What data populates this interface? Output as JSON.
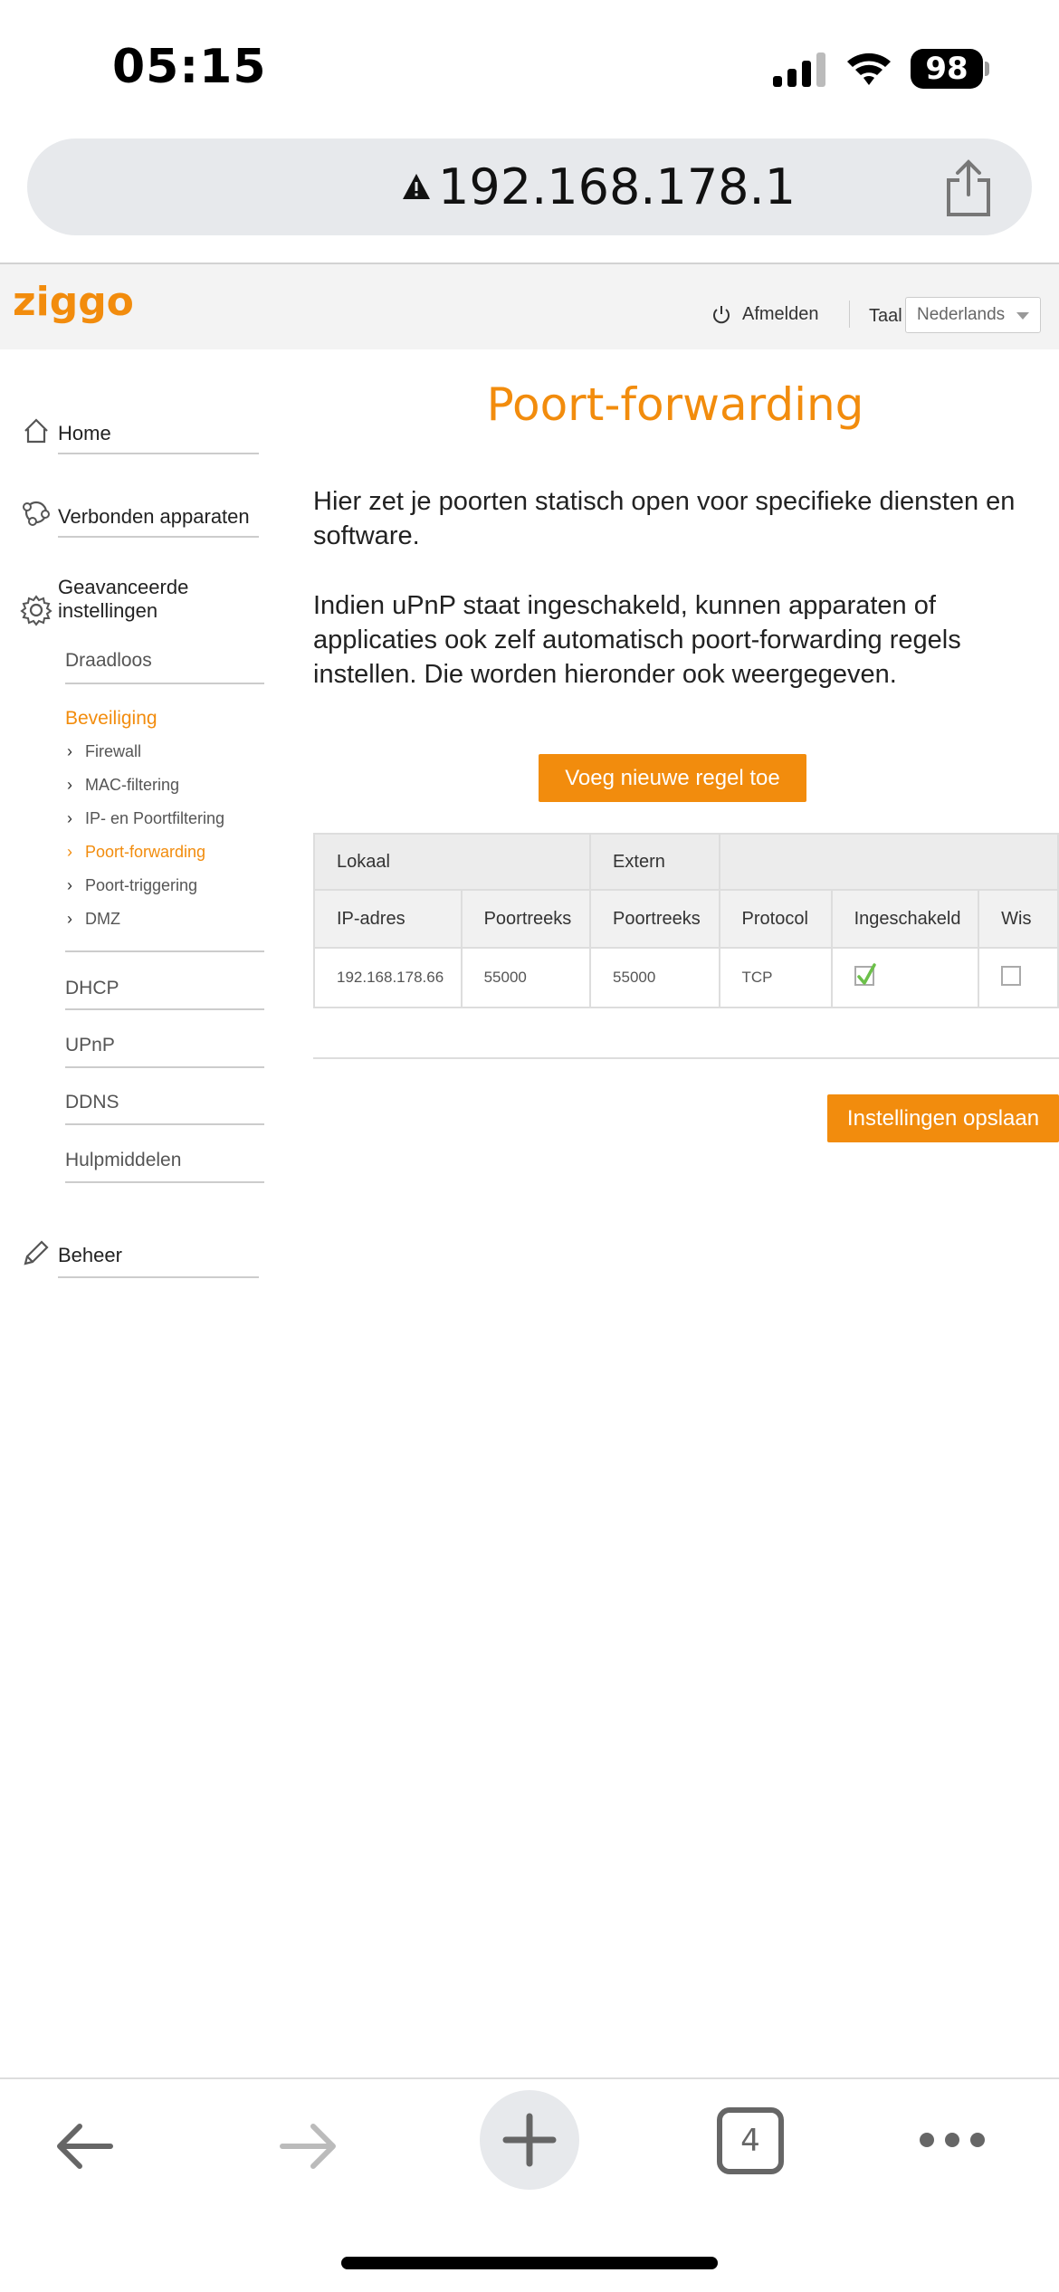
{
  "status_bar": {
    "time": "05:15",
    "battery": "98"
  },
  "browser": {
    "url": "192.168.178.1",
    "tabs_count": "4"
  },
  "header": {
    "brand": "ziggo",
    "logout_label": "Afmelden",
    "language_label": "Taal",
    "language_value": "Nederlands"
  },
  "sidebar": {
    "home": "Home",
    "connected_devices": "Verbonden apparaten",
    "advanced_line1": "Geavanceerde",
    "advanced_line2": "instellingen",
    "wireless": "Draadloos",
    "security": "Beveiliging",
    "security_items": [
      "Firewall",
      "MAC-filtering",
      "IP- en Poortfiltering",
      "Poort-forwarding",
      "Poort-triggering",
      "DMZ"
    ],
    "dhcp": "DHCP",
    "upnp": "UPnP",
    "ddns": "DDNS",
    "tools": "Hulpmiddelen",
    "management": "Beheer"
  },
  "main": {
    "title": "Poort-forwarding",
    "intro1": "Hier zet je poorten statisch open voor specifieke diensten en software.",
    "intro2": "Indien uPnP staat ingeschakeld, kunnen apparaten of applicaties ook zelf automatisch poort-forwarding regels instellen. Die worden hieronder ook weergegeven.",
    "add_rule_button": "Voeg nieuwe regel toe",
    "save_button": "Instellingen opslaan",
    "table": {
      "group_local": "Lokaal",
      "group_external": "Extern",
      "headers": [
        "IP-adres",
        "Poortreeks",
        "Poortreeks",
        "Protocol",
        "Ingeschakeld",
        "Wis"
      ],
      "rows": [
        {
          "ip": "192.168.178.66",
          "local_ports": "55000",
          "external_ports": "55000",
          "protocol": "TCP",
          "enabled": true,
          "delete": false
        }
      ]
    }
  },
  "colors": {
    "accent": "#f28c0d",
    "check": "#6cc04a"
  }
}
